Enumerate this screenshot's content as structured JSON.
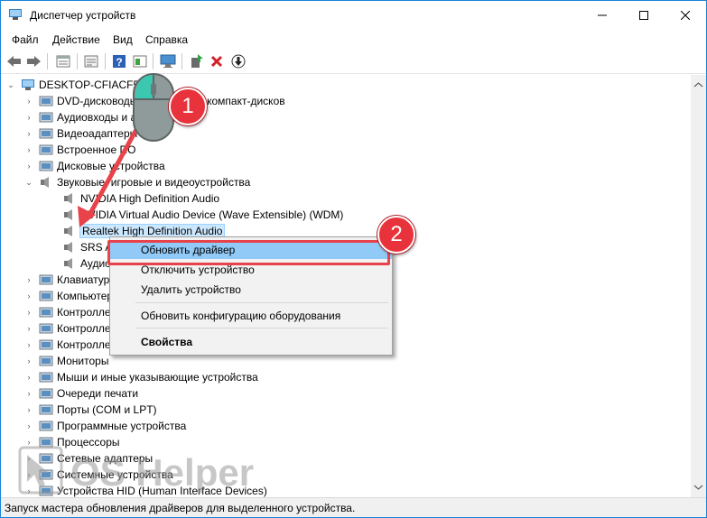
{
  "window": {
    "title": "Диспетчер устройств",
    "controls": {
      "minimize": "—",
      "maximize": "☐",
      "close": "✕"
    }
  },
  "menu": [
    "Файл",
    "Действие",
    "Вид",
    "Справка"
  ],
  "toolbar": {
    "icons": [
      "back-arrow-icon",
      "forward-arrow-icon",
      "properties-icon",
      "show-hide-icon",
      "help-icon",
      "view-icon",
      "monitor-icon",
      "update-driver-icon",
      "uninstall-icon",
      "download-icon"
    ]
  },
  "tree": {
    "root": "DESKTOP-CFIACF5",
    "items": [
      {
        "label": "DVD-дисководы и дисководы компакт-дисков",
        "expanded": false
      },
      {
        "label": "Аудиовходы и аудиовыходы",
        "expanded": false
      },
      {
        "label": "Видеоадаптеры",
        "expanded": false
      },
      {
        "label": "Встроенное ПО",
        "expanded": false
      },
      {
        "label": "Дисковые устройства",
        "expanded": false
      },
      {
        "label": "Звуковые, игровые и видеоустройства",
        "expanded": true
      },
      {
        "label": "NVIDIA High Definition Audio",
        "child": true
      },
      {
        "label": "NVIDIA Virtual Audio Device (Wave Extensible) (WDM)",
        "child": true
      },
      {
        "label": "Realtek High Definition Audio",
        "child": true,
        "selected": true
      },
      {
        "label": "SRS Audio Sandbox",
        "child": true
      },
      {
        "label": "Аудиоустройства Bluetooth",
        "child": true
      },
      {
        "label": "Клавиатуры",
        "expanded": false
      },
      {
        "label": "Компьютер",
        "expanded": false
      },
      {
        "label": "Контроллеры IDE ATA/ATAPI",
        "expanded": false
      },
      {
        "label": "Контроллеры USB",
        "expanded": false
      },
      {
        "label": "Контроллеры запоминающих устройств",
        "expanded": false
      },
      {
        "label": "Мониторы",
        "expanded": false
      },
      {
        "label": "Мыши и иные указывающие устройства",
        "expanded": false
      },
      {
        "label": "Очереди печати",
        "expanded": false
      },
      {
        "label": "Порты (COM и LPT)",
        "expanded": false
      },
      {
        "label": "Программные устройства",
        "expanded": false
      },
      {
        "label": "Процессоры",
        "expanded": false
      },
      {
        "label": "Сетевые адаптеры",
        "expanded": false
      },
      {
        "label": "Системные устройства",
        "expanded": false
      },
      {
        "label": "Устройства HID (Human Interface Devices)",
        "expanded": false
      }
    ]
  },
  "context_menu": {
    "items": [
      "Обновить драйвер",
      "Отключить устройство",
      "Удалить устройство",
      "Обновить конфигурацию оборудования",
      "Свойства"
    ],
    "highlighted": "Обновить драйвер"
  },
  "annotations": {
    "badge1": "1",
    "badge2": "2"
  },
  "watermark": "OS Helper",
  "status": "Запуск мастера обновления драйверов для выделенного устройства.",
  "colors": {
    "accent": "#1883d7",
    "highlight": "#91c9f7",
    "callout": "#e8323c"
  }
}
